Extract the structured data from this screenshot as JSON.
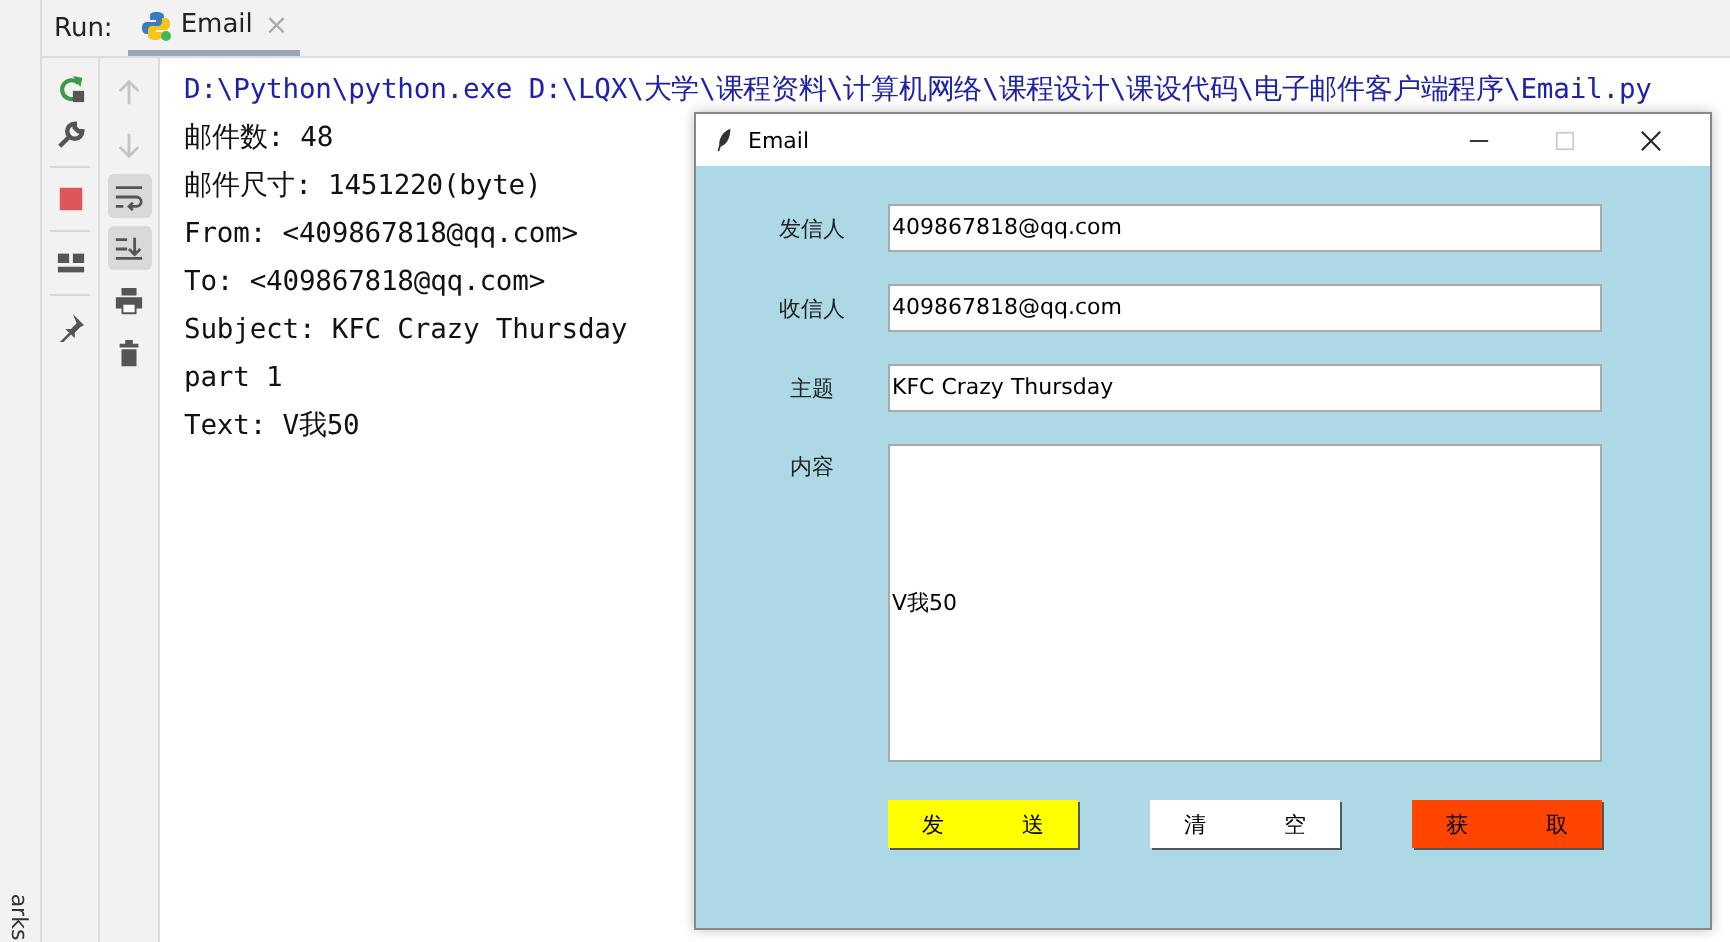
{
  "run_bar": {
    "label": "Run:",
    "tabs": [
      {
        "label": "Email",
        "selected": true,
        "close": "×"
      }
    ]
  },
  "side_strip": {
    "label": "arks"
  },
  "toolbar_left": [
    {
      "kind": "rerun"
    },
    {
      "kind": "wrench"
    },
    {
      "kind": "stop"
    },
    {
      "kind": "layout"
    },
    {
      "kind": "pin"
    }
  ],
  "toolbar_right": [
    {
      "kind": "up",
      "on": false,
      "disabled": true
    },
    {
      "kind": "down",
      "on": false,
      "disabled": true
    },
    {
      "kind": "wrap",
      "on": true,
      "disabled": false
    },
    {
      "kind": "scroll-end",
      "on": true,
      "disabled": false
    },
    {
      "kind": "print",
      "on": false,
      "disabled": false
    },
    {
      "kind": "trash",
      "on": false,
      "disabled": false
    }
  ],
  "console": [
    {
      "kind": "command",
      "text": "D:\\Python\\python.exe D:\\LQX\\大学\\课程资料\\计算机网络\\课程设计\\课设代码\\电子邮件客户端程序\\Email.py"
    },
    {
      "kind": "output",
      "text": "邮件数: 48"
    },
    {
      "kind": "output",
      "text": "邮件尺寸: 1451220(byte)"
    },
    {
      "kind": "output",
      "text": "From:  <409867818@qq.com>"
    },
    {
      "kind": "output",
      "text": "To:  <409867818@qq.com>"
    },
    {
      "kind": "output",
      "text": "Subject: KFC Crazy Thursday"
    },
    {
      "kind": "output",
      "text": "part 1"
    },
    {
      "kind": "output",
      "text": "Text: V我50"
    }
  ],
  "email_window": {
    "title": "Email",
    "maximize_disabled": true,
    "fields": [
      {
        "label": "发信人",
        "value": "409867818@qq.com"
      },
      {
        "label": "收信人",
        "value": "409867818@qq.com"
      },
      {
        "label": "主题",
        "value": "KFC Crazy Thursday"
      }
    ],
    "content": {
      "label": "内容",
      "value": "V我50"
    },
    "buttons": [
      {
        "label": "发 送",
        "color": "#ffff00"
      },
      {
        "label": "清 空",
        "color": "#ffffff"
      },
      {
        "label": "获 取",
        "color": "#ff4500"
      }
    ]
  }
}
